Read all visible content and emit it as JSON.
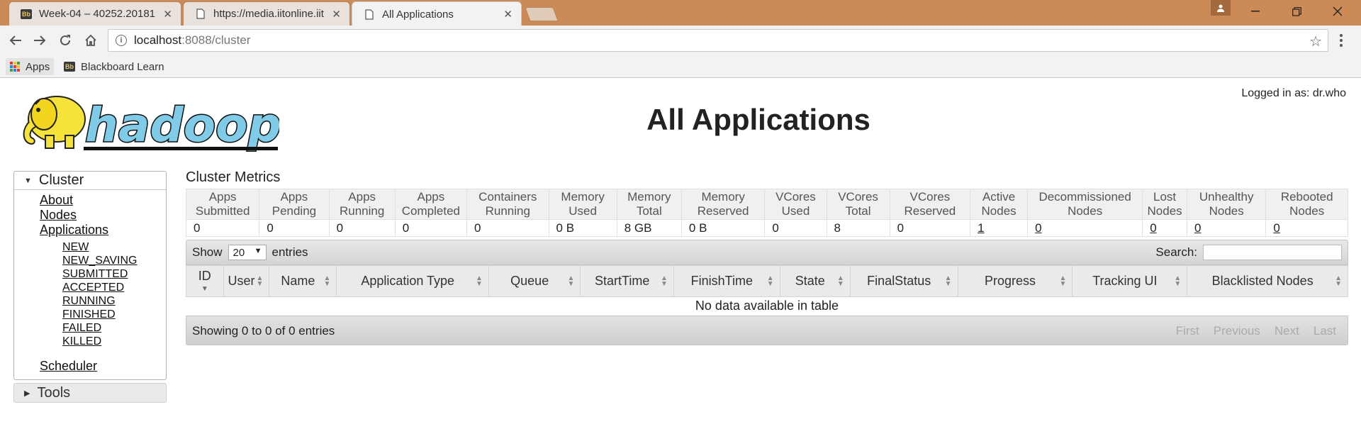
{
  "browser": {
    "tabs": [
      {
        "title": "Week-04 – 40252.20181…",
        "icon": "blackboard-icon",
        "active": false
      },
      {
        "title": "https://media.iitonline.iit…",
        "icon": "page-icon",
        "active": false
      },
      {
        "title": "All Applications",
        "icon": "page-icon",
        "active": true
      }
    ],
    "address": {
      "host": "localhost",
      "path": ":8088/cluster"
    },
    "bookmarks": [
      {
        "label": "Apps",
        "icon": "apps-grid-icon"
      },
      {
        "label": "Blackboard Learn",
        "icon": "blackboard-icon",
        "icon_text": "Bb"
      }
    ]
  },
  "header": {
    "logo_text": "hadoop",
    "title": "All Applications",
    "logged_in": "Logged in as: dr.who"
  },
  "sidebar": {
    "cluster": {
      "heading": "Cluster",
      "links": [
        "About",
        "Nodes",
        "Applications"
      ],
      "states": [
        "NEW",
        "NEW_SAVING",
        "SUBMITTED",
        "ACCEPTED",
        "RUNNING",
        "FINISHED",
        "FAILED",
        "KILLED"
      ],
      "scheduler": "Scheduler"
    },
    "tools": {
      "heading": "Tools"
    }
  },
  "metrics": {
    "title": "Cluster Metrics",
    "headers": [
      [
        "Apps",
        "Submitted"
      ],
      [
        "Apps",
        "Pending"
      ],
      [
        "Apps",
        "Running"
      ],
      [
        "Apps",
        "Completed"
      ],
      [
        "Containers",
        "Running"
      ],
      [
        "Memory",
        "Used"
      ],
      [
        "Memory",
        "Total"
      ],
      [
        "Memory",
        "Reserved"
      ],
      [
        "VCores",
        "Used"
      ],
      [
        "VCores",
        "Total"
      ],
      [
        "VCores",
        "Reserved"
      ],
      [
        "Active",
        "Nodes"
      ],
      [
        "Decommissioned",
        "Nodes"
      ],
      [
        "Lost",
        "Nodes"
      ],
      [
        "Unhealthy",
        "Nodes"
      ],
      [
        "Rebooted",
        "Nodes"
      ]
    ],
    "values": [
      "0",
      "0",
      "0",
      "0",
      "0",
      "0 B",
      "8 GB",
      "0 B",
      "0",
      "8",
      "0",
      "1",
      "0",
      "0",
      "0",
      "0"
    ],
    "linked": [
      false,
      false,
      false,
      false,
      false,
      false,
      false,
      false,
      false,
      false,
      false,
      true,
      true,
      true,
      true,
      true
    ]
  },
  "apps_table": {
    "show_label": "Show",
    "page_size": "20",
    "entries_label": "entries",
    "search_label": "Search:",
    "columns": [
      "ID",
      "User",
      "Name",
      "Application Type",
      "Queue",
      "StartTime",
      "FinishTime",
      "State",
      "FinalStatus",
      "Progress",
      "Tracking UI",
      "Blacklisted Nodes"
    ],
    "empty_message": "No data available in table",
    "info": "Showing 0 to 0 of 0 entries",
    "pagination": [
      "First",
      "Previous",
      "Next",
      "Last"
    ]
  },
  "colors": {
    "titlebar": "#cb8a56",
    "logo_blue": "#7fcbe8",
    "logo_yellow": "#f6e33a"
  }
}
